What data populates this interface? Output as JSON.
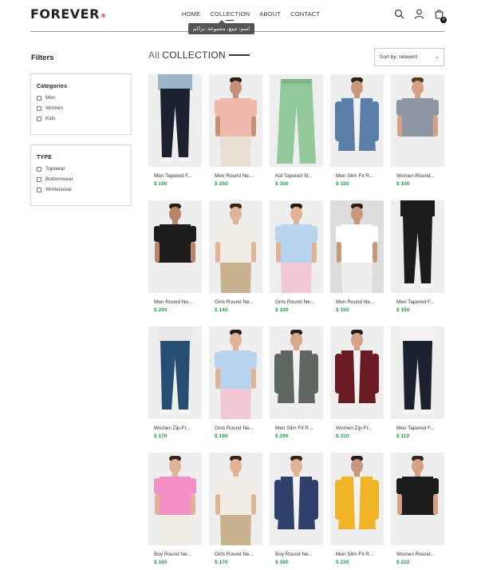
{
  "header": {
    "logo": "FOREVER",
    "nav": [
      "HOME",
      "COLLECTION",
      "ABOUT",
      "CONTACT"
    ],
    "tooltip": "اسم: جمع، مجموعة، تراكم",
    "cart_count": "0"
  },
  "filters": {
    "title": "Filters",
    "categories_title": "Categories",
    "categories": [
      "Men",
      "Women",
      "Kids"
    ],
    "type_title": "TYPE",
    "types": [
      "Topwear",
      "Bottomwear",
      "Winterwear"
    ]
  },
  "collection": {
    "title_a": "All",
    "title_b": "COLLECTION",
    "sort": "Sort by: relavent"
  },
  "colors": {
    "price": "#1e9d47",
    "accent": "#e07a8f"
  },
  "products": [
    {
      "name": "Men Tapered F...",
      "price": "$ 190",
      "top": "#9bb4c8",
      "bottom": "#1d2230",
      "skin": "#d8a88a",
      "hair": "#2a1e17",
      "kind": "pants",
      "bg": "#eeeeee"
    },
    {
      "name": "Men Round Ne...",
      "price": "$ 250",
      "top": "#f1b9ae",
      "bottom": "#e9ded2",
      "skin": "#c79075",
      "hair": "#2a1e17",
      "kind": "tee",
      "bg": "#eeeeee"
    },
    {
      "name": "Kid Tapered Sl...",
      "price": "$ 300",
      "top": "#93c99a",
      "bottom": "#93c99a",
      "skin": "#d8a88a",
      "hair": "#2a1e17",
      "kind": "flat",
      "bg": "#eeeeee"
    },
    {
      "name": "Men Slim Fit R...",
      "price": "$ 320",
      "top": "#5b7ea8",
      "bottom": "#f3f3f3",
      "skin": "#c9977a",
      "hair": "#2a1e17",
      "kind": "jacket",
      "bg": "#eeeeee"
    },
    {
      "name": "Women Round...",
      "price": "$ 100",
      "top": "#8d96a3",
      "bottom": "#eeeeee",
      "skin": "#d5a285",
      "hair": "#5a3a25",
      "kind": "tee",
      "bg": "#eeeeee"
    },
    {
      "name": "Men Round Ne...",
      "price": "$ 200",
      "top": "#1c1c1c",
      "bottom": "#eeeeee",
      "skin": "#b9856a",
      "hair": "#2a1e17",
      "kind": "tee",
      "bg": "#eeeeee"
    },
    {
      "name": "Girls Round Ne...",
      "price": "$ 140",
      "top": "#f2ede4",
      "bottom": "#c9b28f",
      "skin": "#e0b296",
      "hair": "#3a2418",
      "kind": "tee",
      "bg": "#eeeeee"
    },
    {
      "name": "Girls Round Ne...",
      "price": "$ 100",
      "top": "#b7d3ee",
      "bottom": "#f3c8d6",
      "skin": "#e0b296",
      "hair": "#2a1a12",
      "kind": "tee",
      "bg": "#eeeeee"
    },
    {
      "name": "Men Round Ne...",
      "price": "$ 150",
      "top": "#ffffff",
      "bottom": "#eeeeee",
      "skin": "#c9977a",
      "hair": "#2a1e17",
      "kind": "tee",
      "bg": "#dddddd"
    },
    {
      "name": "Men Tapered F...",
      "price": "$ 150",
      "top": "#1c1c1c",
      "bottom": "#1c1c1c",
      "skin": "#c9977a",
      "hair": "#2a1e17",
      "kind": "pants",
      "bg": "#eeeeee"
    },
    {
      "name": "Women Zip-Fr...",
      "price": "$ 170",
      "top": "#e8e8e8",
      "bottom": "#264e73",
      "skin": "#d5a285",
      "hair": "#3a2418",
      "kind": "pants",
      "bg": "#eeeeee"
    },
    {
      "name": "Girls Round Ne...",
      "price": "$ 190",
      "top": "#b7d3ee",
      "bottom": "#f3c8d6",
      "skin": "#e0b296",
      "hair": "#2a1a12",
      "kind": "tee",
      "bg": "#eeeeee"
    },
    {
      "name": "Men Slim Fit R...",
      "price": "$ 290",
      "top": "#5f6660",
      "bottom": "#1c1c1c",
      "skin": "#d8a88a",
      "hair": "#2a1e17",
      "kind": "jacket",
      "bg": "#eeeeee"
    },
    {
      "name": "Women Zip-Fr...",
      "price": "$ 310",
      "top": "#6a1a22",
      "bottom": "#1c1c1c",
      "skin": "#d5a285",
      "hair": "#2a1a12",
      "kind": "jacket",
      "bg": "#eeeeee"
    },
    {
      "name": "Men Tapered F...",
      "price": "$ 110",
      "top": "#f3f3f3",
      "bottom": "#1d2230",
      "skin": "#d8a88a",
      "hair": "#2a1e17",
      "kind": "pants",
      "bg": "#eeeeee"
    },
    {
      "name": "Boy Round Ne...",
      "price": "$ 160",
      "top": "#f48fc6",
      "bottom": "#f2ede4",
      "skin": "#e0b296",
      "hair": "#3a2418",
      "kind": "tee",
      "bg": "#eeeeee"
    },
    {
      "name": "Girls Round Ne...",
      "price": "$ 170",
      "top": "#f2ede4",
      "bottom": "#c9b28f",
      "skin": "#e0b296",
      "hair": "#3a2418",
      "kind": "tee",
      "bg": "#eeeeee"
    },
    {
      "name": "Boy Round Ne...",
      "price": "$ 180",
      "top": "#2f3f6b",
      "bottom": "#3d5a85",
      "skin": "#e0b296",
      "hair": "#3a2418",
      "kind": "jacket",
      "bg": "#eeeeee"
    },
    {
      "name": "Men Slim Fit R...",
      "price": "$ 230",
      "top": "#f0b429",
      "bottom": "#3d5a85",
      "skin": "#c9977a",
      "hair": "#2a1e17",
      "kind": "jacket",
      "bg": "#eeeeee"
    },
    {
      "name": "Women Round...",
      "price": "$ 210",
      "top": "#1c1c1c",
      "bottom": "#eeeeee",
      "skin": "#d5a285",
      "hair": "#3a2418",
      "kind": "tee",
      "bg": "#eeeeee"
    }
  ]
}
